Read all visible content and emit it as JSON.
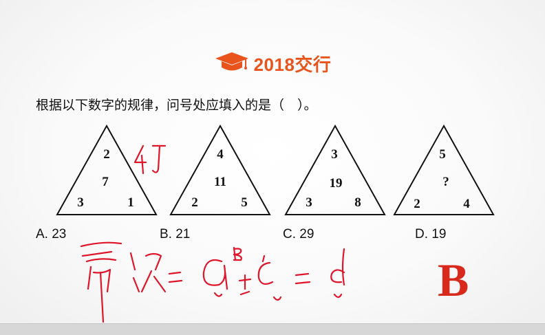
{
  "header": {
    "title": "2018交行",
    "icon": "graduation-cap-icon",
    "accent_color": "#e8541c"
  },
  "question": "根据以下数字的规律，问号处应填入的是（　）。",
  "triangles": [
    {
      "top": "2",
      "middle": "7",
      "left": "3",
      "right": "1"
    },
    {
      "top": "4",
      "middle": "11",
      "left": "2",
      "right": "5"
    },
    {
      "top": "3",
      "middle": "19",
      "left": "3",
      "right": "8"
    },
    {
      "top": "5",
      "middle": "?",
      "left": "2",
      "right": "4"
    }
  ],
  "options": [
    {
      "label": "A. 23"
    },
    {
      "label": "B. 21"
    },
    {
      "label": "C. 29"
    },
    {
      "label": "D. 19"
    }
  ],
  "answer": "B",
  "answer_color": "#d9281c",
  "handwriting_color": "#e0152a"
}
